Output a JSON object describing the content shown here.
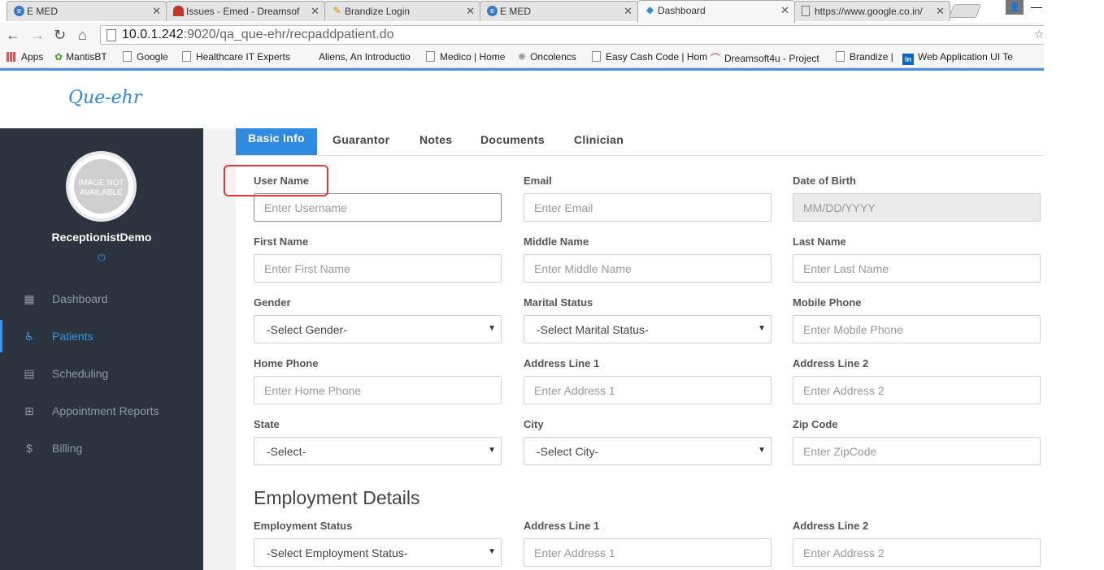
{
  "browser": {
    "tabs": [
      {
        "title": "E MED",
        "favicon": "emed-icon"
      },
      {
        "title": "Issues - Emed - Dreamsof",
        "favicon": "redmine-icon"
      },
      {
        "title": "Brandize Login",
        "favicon": "wand-icon"
      },
      {
        "title": "E MED",
        "favicon": "emed-icon"
      },
      {
        "title": "Dashboard",
        "favicon": "layers-icon"
      },
      {
        "title": "https://www.google.co.in/",
        "favicon": "page-icon"
      }
    ],
    "url_host": "10.0.1.242",
    "url_rest": ":9020/qa_que-ehr/recpaddpatient.do",
    "bookmarks": [
      "Apps",
      "MantisBT",
      "Google",
      "Healthcare IT Experts",
      "Aliens, An Introductio",
      "Medico | Home",
      "Oncolencs",
      "Easy Cash Code | Hom",
      "Dreamsoft4u - Project",
      "Brandize |",
      "Web Application UI Te"
    ]
  },
  "app": {
    "logo": "Que-ehr",
    "avatar_text": "IMAGE NOT AVAILABLE",
    "user": "ReceptionistDemo",
    "nav": [
      {
        "label": "Dashboard",
        "icon": "dashboard-icon"
      },
      {
        "label": "Patients",
        "icon": "wheelchair-icon",
        "active": true
      },
      {
        "label": "Scheduling",
        "icon": "calendar-icon"
      },
      {
        "label": "Appointment Reports",
        "icon": "calendar-plus-icon"
      },
      {
        "label": "Billing",
        "icon": "dollar-icon"
      }
    ]
  },
  "form": {
    "tabs": [
      "Basic Info",
      "Guarantor",
      "Notes",
      "Documents",
      "Clinician"
    ],
    "fields": {
      "username": {
        "label": "User Name",
        "placeholder": "Enter Username"
      },
      "email": {
        "label": "Email",
        "placeholder": "Enter Email"
      },
      "dob": {
        "label": "Date of Birth",
        "placeholder": "MM/DD/YYYY"
      },
      "first_name": {
        "label": "First Name",
        "placeholder": "Enter First Name"
      },
      "middle_name": {
        "label": "Middle Name",
        "placeholder": "Enter Middle Name"
      },
      "last_name": {
        "label": "Last Name",
        "placeholder": "Enter Last Name"
      },
      "gender": {
        "label": "Gender",
        "value": "-Select Gender-"
      },
      "marital": {
        "label": "Marital Status",
        "value": "-Select Marital Status-"
      },
      "mobile": {
        "label": "Mobile Phone",
        "placeholder": "Enter Mobile Phone"
      },
      "home_phone": {
        "label": "Home Phone",
        "placeholder": "Enter Home Phone"
      },
      "addr1": {
        "label": "Address Line 1",
        "placeholder": "Enter Address 1"
      },
      "addr2": {
        "label": "Address Line 2",
        "placeholder": "Enter Address 2"
      },
      "state": {
        "label": "State",
        "value": "-Select-"
      },
      "city": {
        "label": "City",
        "value": "-Select City-"
      },
      "zip": {
        "label": "Zip Code",
        "placeholder": "Enter ZipCode"
      }
    },
    "employment": {
      "title": "Employment Details",
      "status": {
        "label": "Employment Status",
        "value": "-Select Employment Status-"
      },
      "addr1": {
        "label": "Address Line 1",
        "placeholder": "Enter Address 1"
      },
      "addr2": {
        "label": "Address Line 2",
        "placeholder": "Enter Address 2"
      }
    }
  },
  "colors": {
    "accent": "#2f8be0",
    "sidebar": "#2b333e",
    "highlight": "#e53935"
  }
}
